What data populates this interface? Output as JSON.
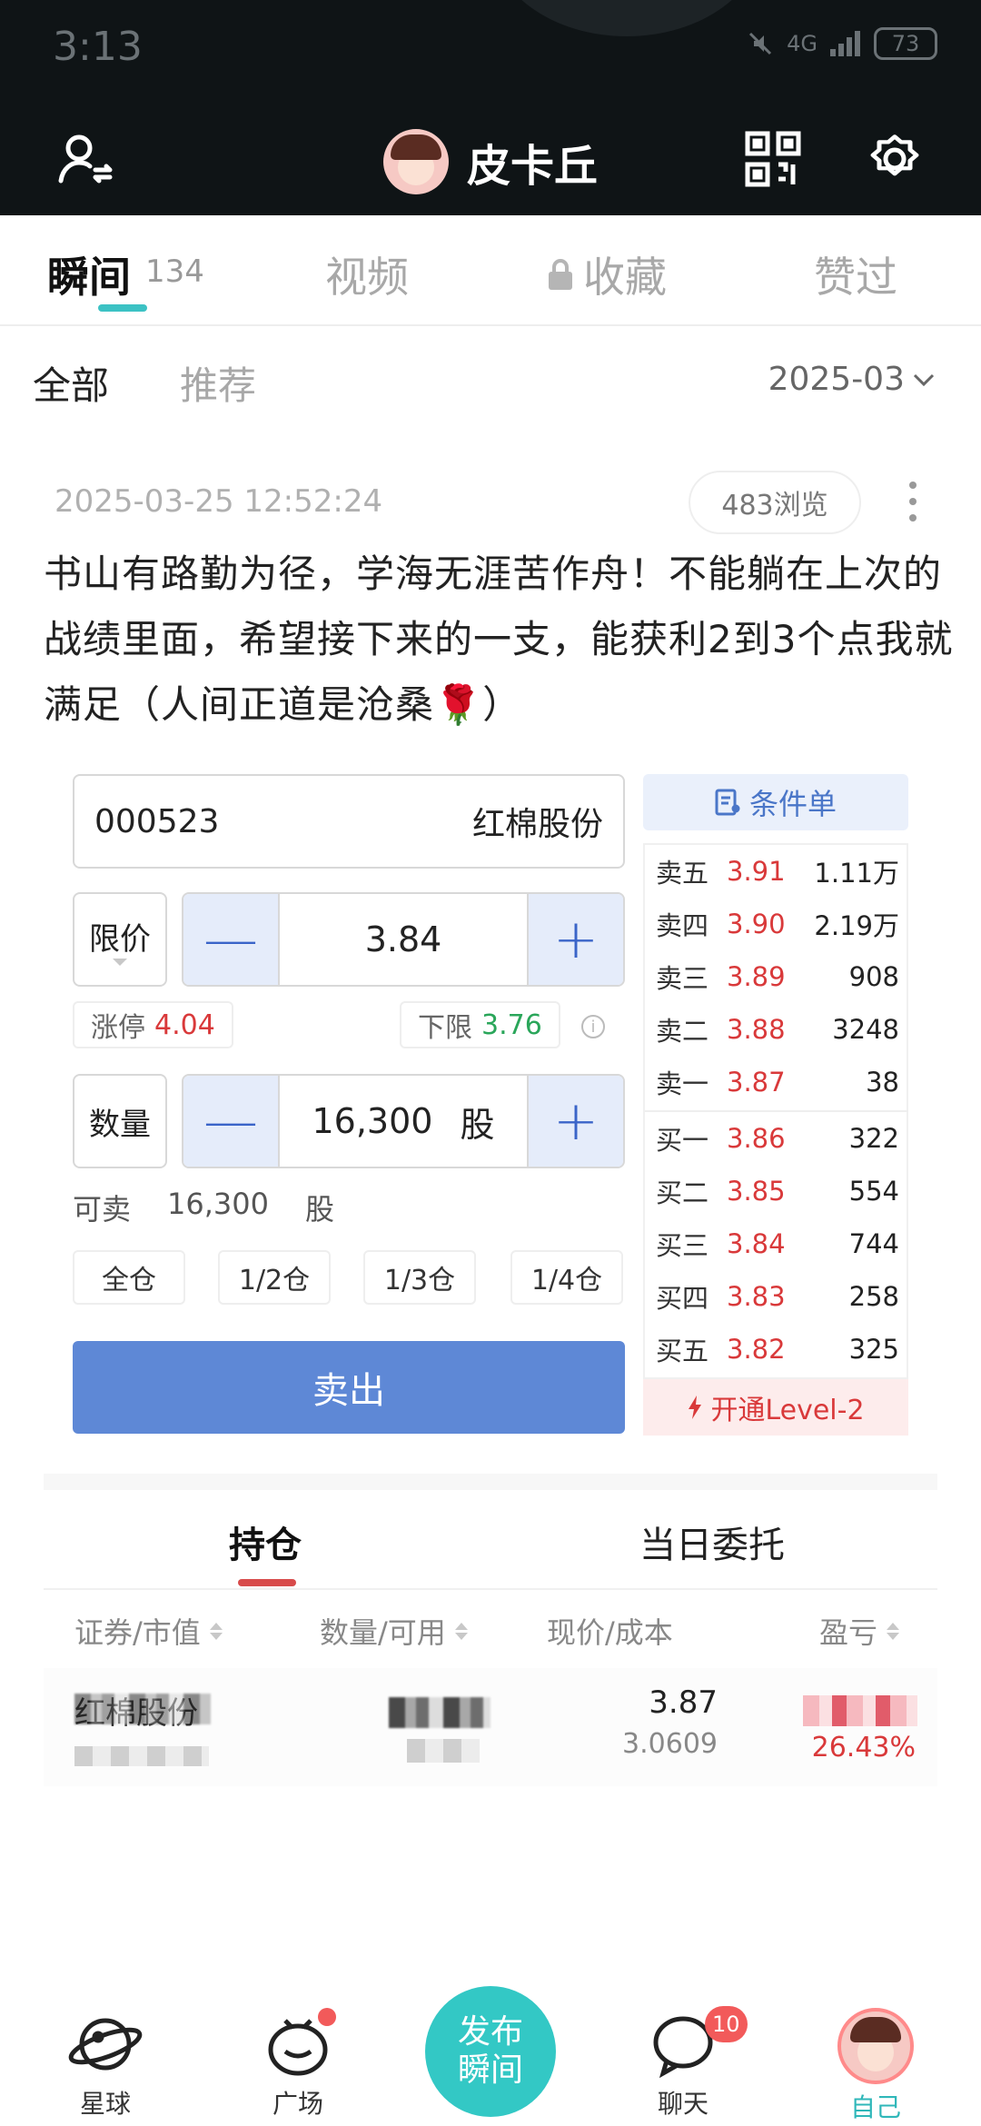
{
  "status_bar": {
    "time": "3:13",
    "network": "4G",
    "battery": "73"
  },
  "header": {
    "username": "皮卡丘"
  },
  "tabs": [
    {
      "label": "瞬间",
      "count": "134"
    },
    {
      "label": "视频"
    },
    {
      "label": "收藏"
    },
    {
      "label": "赞过"
    }
  ],
  "filters": {
    "all": "全部",
    "recommend": "推荐",
    "date": "2025-03"
  },
  "post": {
    "timestamp": "2025-03-25 12:52:24",
    "views": "483浏览",
    "text": "书山有路勤为径，学海无涯苦作舟！不能躺在上次的战绩里面，希望接下来的一支，能获利2到3个点我就满足（人间正道是沧桑🌹）"
  },
  "trade": {
    "stock_code": "000523",
    "stock_name": "红棉股份",
    "price_type": "限价",
    "price": "3.84",
    "limit_up_label": "涨停",
    "limit_up": "4.04",
    "limit_down_label": "下限",
    "limit_down": "3.76",
    "qty_label": "数量",
    "qty": "16,300",
    "qty_unit": "股",
    "available_label": "可卖",
    "available": "16,300",
    "available_unit": "股",
    "position_buttons": [
      "全仓",
      "1/2仓",
      "1/3仓",
      "1/4仓"
    ],
    "sell_label": "卖出",
    "condition_label": "条件单",
    "level2_label": "开通Level-2",
    "minus": "—",
    "plus": "+"
  },
  "order_book": {
    "asks": [
      {
        "label": "卖五",
        "price": "3.91",
        "volume": "1.11万"
      },
      {
        "label": "卖四",
        "price": "3.90",
        "volume": "2.19万"
      },
      {
        "label": "卖三",
        "price": "3.89",
        "volume": "908"
      },
      {
        "label": "卖二",
        "price": "3.88",
        "volume": "3248"
      },
      {
        "label": "卖一",
        "price": "3.87",
        "volume": "38"
      }
    ],
    "bids": [
      {
        "label": "买一",
        "price": "3.86",
        "volume": "322"
      },
      {
        "label": "买二",
        "price": "3.85",
        "volume": "554"
      },
      {
        "label": "买三",
        "price": "3.84",
        "volume": "744"
      },
      {
        "label": "买四",
        "price": "3.83",
        "volume": "258"
      },
      {
        "label": "买五",
        "price": "3.82",
        "volume": "325"
      }
    ]
  },
  "holdings": {
    "tabs": [
      "持仓",
      "当日委托"
    ],
    "columns": [
      "证券/市值",
      "数量/可用",
      "现价/成本",
      "盈亏"
    ],
    "row": {
      "name": "红棉股份",
      "price": "3.87",
      "cost": "3.0609",
      "pnl_pct": "26.43%"
    }
  },
  "bottom_nav": {
    "planet": "星球",
    "square": "广场",
    "publish_line1": "发布",
    "publish_line2": "瞬间",
    "chat": "聊天",
    "chat_badge": "10",
    "me": "自己"
  },
  "colors": {
    "accent": "#33c8c5",
    "sell": "#5e88d6",
    "up": "#d9393a",
    "down": "#2aa65a"
  }
}
